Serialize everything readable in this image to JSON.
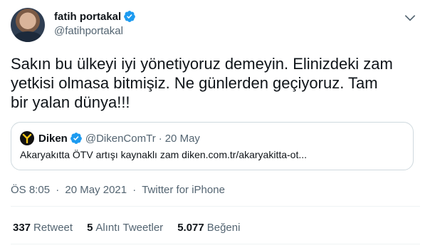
{
  "author": {
    "name": "fatih portakal",
    "handle": "@fatihportakal",
    "verified": true
  },
  "tweet": {
    "text": "Sakın bu ülkeyi iyi yönetiyoruz demeyin. Elinizdeki zam\nyetkisi olmasa bitmişiz. Ne günlerden geçiyoruz. Tam\nbir yalan dünya!!!"
  },
  "quoted": {
    "name": "Diken",
    "handle": "@DikenComTr",
    "dot": "·",
    "time": "20 May",
    "text": "Akaryakıtta ÖTV artışı kaynaklı zam diken.com.tr/akaryakitta-ot..."
  },
  "meta": {
    "time": "ÖS 8:05",
    "date": "20 May 2021",
    "source": "Twitter for iPhone",
    "sep": "·"
  },
  "stats": {
    "retweets": {
      "count": "337",
      "label": "Retweet"
    },
    "quotes": {
      "count": "5",
      "label": "Alıntı Tweetler"
    },
    "likes": {
      "count": "5.077",
      "label": "Beğeni"
    }
  },
  "colors": {
    "verified": "#1d9bf0",
    "muted": "#536471",
    "text": "#0f1419",
    "border": "#cfd9de",
    "diken_logo": "#f5c518"
  },
  "icons": {
    "verified": "verified-badge-icon",
    "caret": "chevron-down-icon",
    "diken": "diken-logo-icon"
  }
}
